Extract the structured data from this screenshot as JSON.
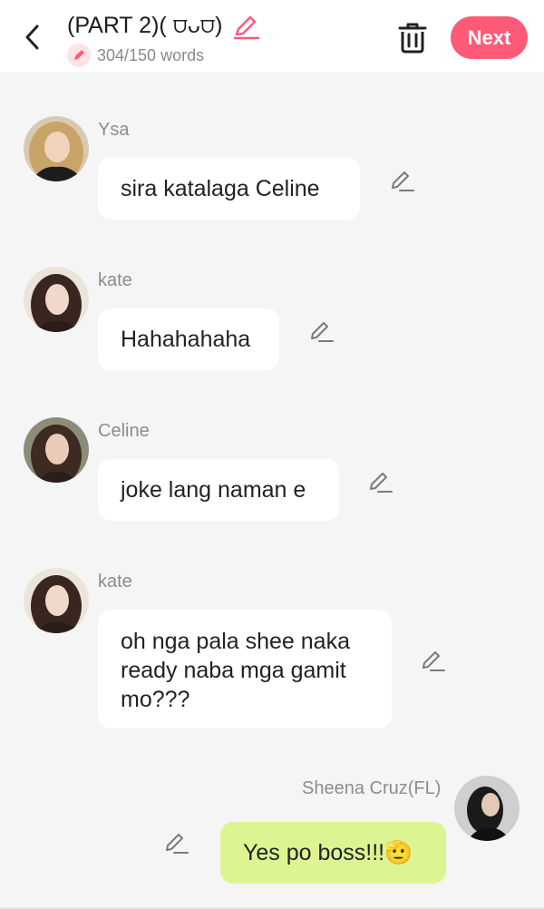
{
  "header": {
    "title": "(PART 2)( ⩌ᴗ⩌)",
    "word_count": "304/150 words",
    "next_label": "Next",
    "accent_color": "#ff5a78"
  },
  "messages": [
    {
      "sender": "Ysa",
      "text": "sira katalaga Celine",
      "side": "left"
    },
    {
      "sender": "kate",
      "text": "Hahahahaha",
      "side": "left"
    },
    {
      "sender": "Celine",
      "text": "joke lang naman e",
      "side": "left"
    },
    {
      "sender": "kate",
      "text": "oh nga pala shee naka ready naba mga gamit mo???",
      "side": "left"
    },
    {
      "sender": "Sheena Cruz(FL)",
      "text": "Yes po boss!!!🫡",
      "side": "right"
    }
  ],
  "icons": {
    "back": "chevron-left-icon",
    "title_edit": "pencil-icon",
    "word_count": "pencil-icon",
    "delete": "trash-icon",
    "message_edit": "pencil-icon"
  }
}
